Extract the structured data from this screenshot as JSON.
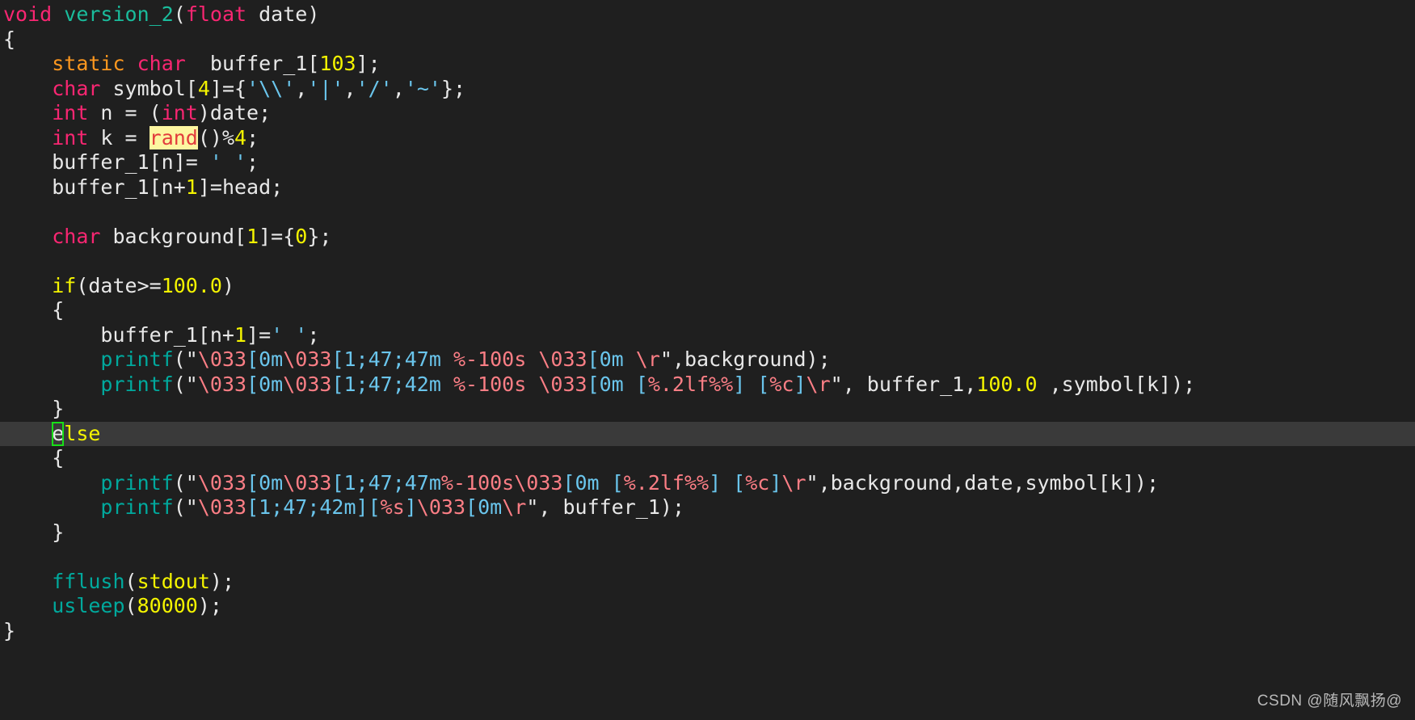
{
  "editor": {
    "language": "C",
    "theme": {
      "background": "#1f1f1f",
      "current_line_background": "#3a3a3a",
      "foreground": "#e8e8e8",
      "keyword": "#f92672",
      "storage": "#fd971f",
      "function_name": "#1abc9c",
      "function_call": "#00a99d",
      "control": "#f4f400",
      "number": "#f4f400",
      "string": "#6ac5ec",
      "escape": "#fb7e85",
      "search_highlight_background": "#fdf6a0",
      "search_highlight_foreground": "#e23c3c",
      "cursor_outline": "#18e018"
    },
    "current_line_index": 17,
    "cursor": {
      "line": 17,
      "column": 4,
      "character": "e"
    },
    "search_match": "rand",
    "lines": [
      {
        "i": 0,
        "text": "void version_2(float date)"
      },
      {
        "i": 1,
        "text": "{"
      },
      {
        "i": 2,
        "text": "    static char  buffer_1[103];"
      },
      {
        "i": 3,
        "text": "    char symbol[4]={'\\\\','|','/','~'};"
      },
      {
        "i": 4,
        "text": "    int n = (int)date;"
      },
      {
        "i": 5,
        "text": "    int k = rand()%4;"
      },
      {
        "i": 6,
        "text": "    buffer_1[n]= ' ';"
      },
      {
        "i": 7,
        "text": "    buffer_1[n+1]=head;"
      },
      {
        "i": 8,
        "text": ""
      },
      {
        "i": 9,
        "text": "    char background[1]={0};"
      },
      {
        "i": 10,
        "text": ""
      },
      {
        "i": 11,
        "text": "    if(date>=100.0)"
      },
      {
        "i": 12,
        "text": "    {"
      },
      {
        "i": 13,
        "text": "        buffer_1[n+1]=' ';"
      },
      {
        "i": 14,
        "text": "        printf(\"\\033[0m\\033[1;47;47m %-100s \\033[0m \\r\",background);"
      },
      {
        "i": 15,
        "text": "        printf(\"\\033[0m\\033[1;47;42m %-100s \\033[0m [%.2lf%%] [%c]\\r\", buffer_1,100.0 ,symbol[k]);"
      },
      {
        "i": 16,
        "text": "    }"
      },
      {
        "i": 17,
        "text": "    else"
      },
      {
        "i": 18,
        "text": "    {"
      },
      {
        "i": 19,
        "text": "        printf(\"\\033[0m\\033[1;47;47m%-100s\\033[0m [%.2lf%%] [%c]\\r\",background,date,symbol[k]);"
      },
      {
        "i": 20,
        "text": "        printf(\"\\033[1;47;42m][%s]\\033[0m\\r\", buffer_1);"
      },
      {
        "i": 21,
        "text": "    }"
      },
      {
        "i": 22,
        "text": ""
      },
      {
        "i": 23,
        "text": "    fflush(stdout);"
      },
      {
        "i": 24,
        "text": "    usleep(80000);"
      },
      {
        "i": 25,
        "text": "}"
      }
    ]
  },
  "watermark": {
    "text": "CSDN @随风飘扬@"
  }
}
